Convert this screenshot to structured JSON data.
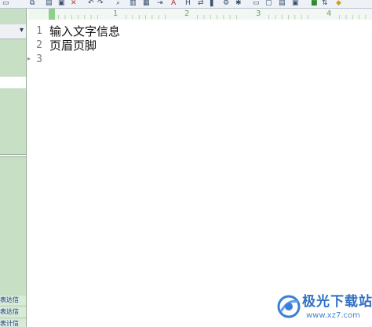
{
  "toolbar": {
    "buttons": [
      {
        "icon": "new-document-icon"
      },
      {
        "icon": "copy-icon"
      },
      {
        "icon": "paste-icon"
      },
      {
        "icon": "delete-icon"
      },
      {
        "icon": "undo-icon"
      },
      {
        "icon": "redo-icon"
      },
      {
        "icon": "find-icon"
      },
      {
        "icon": "format-icon"
      },
      {
        "icon": "column-icon"
      },
      {
        "icon": "font-color-icon"
      },
      {
        "icon": "font-icon"
      },
      {
        "icon": "wrap-icon"
      },
      {
        "icon": "settings-icon"
      },
      {
        "icon": "view-icon"
      },
      {
        "icon": "window-icon"
      },
      {
        "icon": "export-icon"
      }
    ]
  },
  "sidepane": {
    "header_arrow": "▾",
    "items": [
      "表达信",
      "表达信",
      "表计信"
    ]
  },
  "ruler": {
    "marks": [
      "1",
      "2",
      "3",
      "4"
    ]
  },
  "editor": {
    "lines": [
      {
        "num": "1",
        "text": "输入文字信息"
      },
      {
        "num": "2",
        "text": "页眉页脚"
      },
      {
        "num": "3",
        "text": ""
      }
    ]
  },
  "watermark": {
    "title": "极光下载站",
    "url": "www.xz7.com"
  },
  "colors": {
    "pane_bg": "#c7dfc5",
    "ruler_accent": "#8fd08f",
    "watermark_blue": "#2f6fc4"
  }
}
